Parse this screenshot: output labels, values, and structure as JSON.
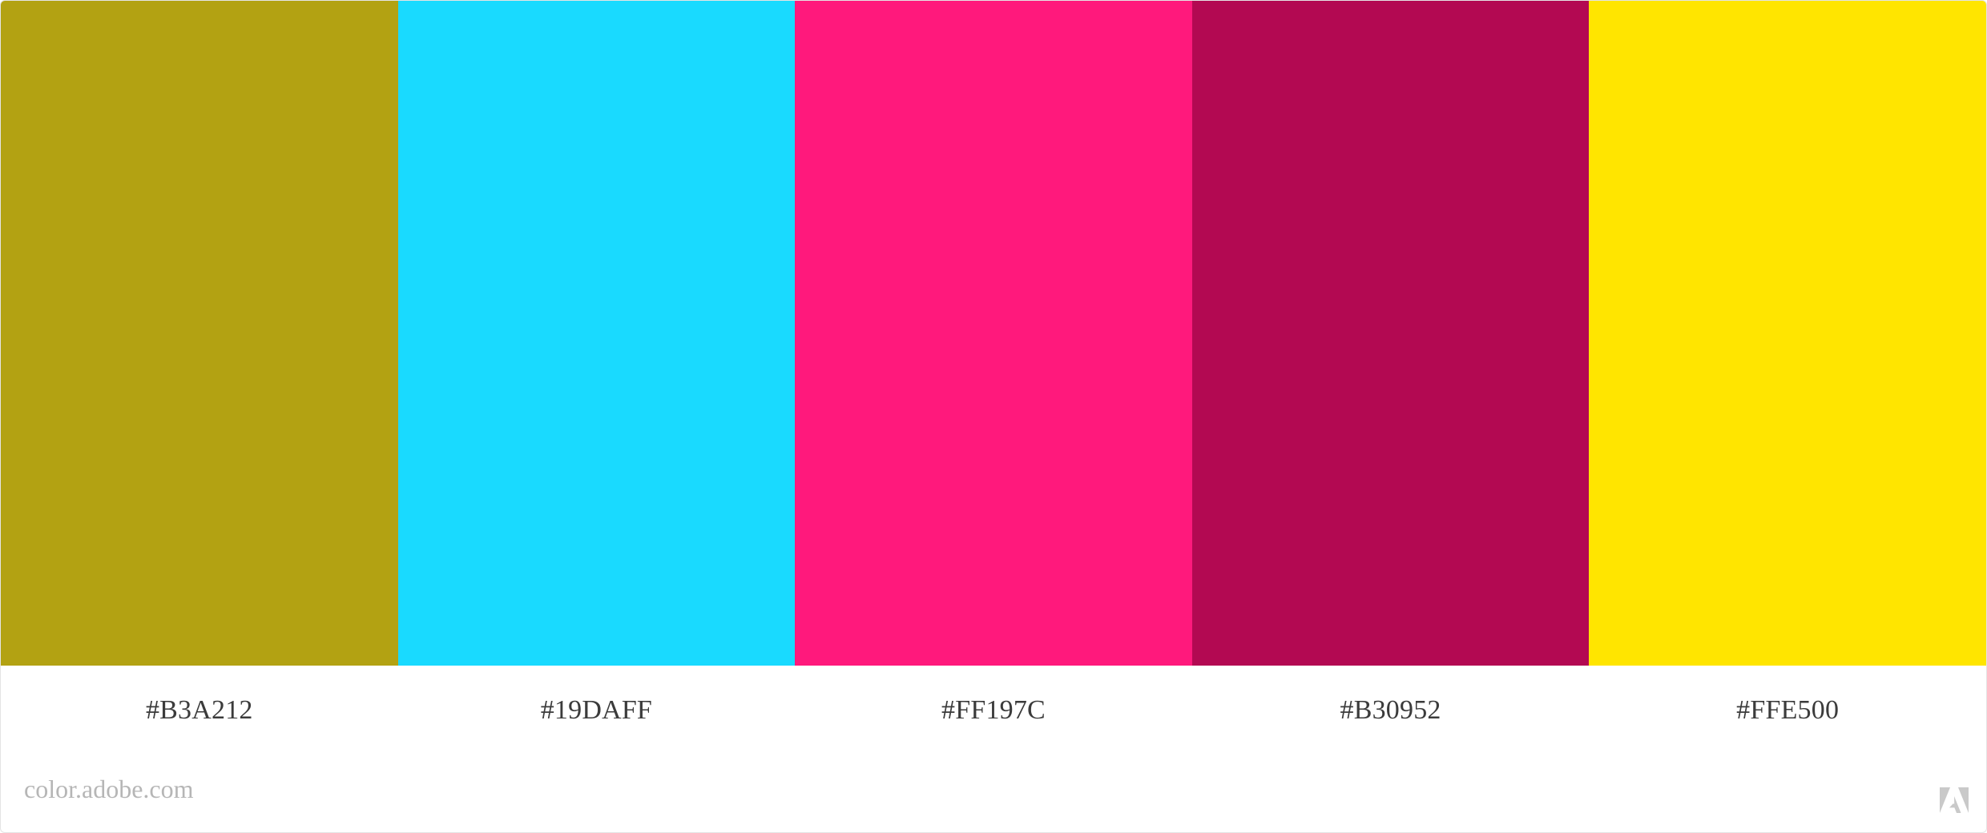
{
  "palette": {
    "swatches": [
      {
        "color": "#B3A212",
        "label": "#B3A212"
      },
      {
        "color": "#19DAFF",
        "label": "#19DAFF"
      },
      {
        "color": "#FF197C",
        "label": "#FF197C"
      },
      {
        "color": "#B30952",
        "label": "#B30952"
      },
      {
        "color": "#FFE500",
        "label": "#FFE500"
      }
    ]
  },
  "footer": {
    "site_text": "color.adobe.com",
    "logo_icon": "adobe-logo-icon"
  },
  "colors": {
    "label_text": "#3b3b3b",
    "footer_text": "#b6b6b6",
    "logo": "#c9c9c9",
    "background": "#ffffff"
  }
}
